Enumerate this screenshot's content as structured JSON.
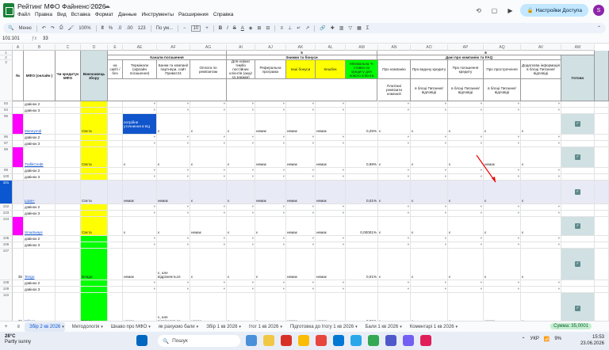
{
  "doc": {
    "title": "Рейтинг МФО Файненс 2026"
  },
  "menu": [
    "Файл",
    "Правка",
    "Вид",
    "Вставка",
    "Формат",
    "Данные",
    "Инструменты",
    "Расширения",
    "Справка"
  ],
  "share_label": "Настройки Доступа",
  "avatar_letter": "S",
  "toolbar": {
    "search": "Меню",
    "zoom": "100%",
    "currency": "₴",
    "percent": "%",
    "decimals": ".0",
    ".00": ".00",
    "format": "123",
    "font": "По ум...",
    "fontsize": "10"
  },
  "formula": {
    "cell": "101:101",
    "value": "33"
  },
  "columns": [
    "",
    "A",
    "B",
    "C",
    "D",
    "E",
    "AE",
    "AF",
    "AG",
    "AI",
    "AJ",
    "AK",
    "AL",
    "AM",
    "AN",
    "AO",
    "AP",
    "AQ",
    "AV",
    "AW"
  ],
  "head": {
    "row1_5": "5",
    "row1_6": "6",
    "channels": "Канали погашення",
    "discounts": "Знижки та бонуси",
    "faq": "Дані про компанію та FAQ",
    "no": "№",
    "mfo": "МФО (онлайн )",
    "credit": "Чи кредитує МФО",
    "executor": "Виконавець збору",
    "h_site": "на сайті / без",
    "h_terminal": "Термінали (офлайн погашення)",
    "h_bank": "Банки та компанії партнери, сайт Приват24",
    "h_req": "Оплата по реквізитам",
    "h_new": "Для нових/ тимбо постійних клієнтів (акції та знижки)",
    "h_ref": "Реферальна програма",
    "h_other": "Інші бонуси",
    "h_cash": "Кешбек",
    "h_min": "Мінімальна % ставка по кредиту для нового клієнта",
    "h_about": "Про компанію",
    "h_issue": "Про видачу кредиту",
    "h_repay": "Про погашення кредиту",
    "h_delay": "Про прострочення",
    "h_extra": "Додаткова інформація в блоці Питання/відповіді",
    "h_ready": "Готово",
    "h_pay": "Платіжні реквізити компанії",
    "h_block": "в блоці Питання/відповіді",
    "h_block2": "в блоці Питання/відповіді",
    "h_block3": "в блоці Питання/відповіді"
  },
  "rows": [
    {
      "num": "93",
      "b": "дзвінок 2"
    },
    {
      "num": "94",
      "b": "дзвінок 3"
    },
    {
      "num": "95",
      "no": "",
      "mfo": "Moneymdi",
      "exec": "Свєта",
      "ae": "потрібне уточнення в КЦ",
      "af": "є",
      "ag": "є",
      "ai": "є",
      "aj": "немає",
      "ak": "немає",
      "al": "немає",
      "am": "0,25%",
      "an": "є",
      "ao": "є",
      "ap": "є",
      "aq": "є",
      "av": "є",
      "ready": true
    },
    {
      "num": "96",
      "b": "дзвінок 2"
    },
    {
      "num": "97",
      "b": "дзвінок 3"
    },
    {
      "num": "98",
      "mfo": "TrafikCredit",
      "exec": "Свєта",
      "ae": "є",
      "af": "є",
      "ag": "є",
      "ai": "є",
      "aj": "немає",
      "ak": "немає",
      "al": "немає",
      "am": "0,99%",
      "an": "є",
      "ao": "є",
      "ap": "є",
      "aq": "немає",
      "av": "є",
      "ready": true
    },
    {
      "num": "99",
      "b": "дзвінок 2"
    },
    {
      "num": "100",
      "b": "дзвінок 3"
    },
    {
      "num": "101",
      "mfo": "Loan+",
      "exec": "Свєта",
      "ae": "немає",
      "af": "немає",
      "ag": "є",
      "ai": "є",
      "aj": "немає",
      "ak": "немає",
      "al": "немає",
      "am": "0,01%",
      "an": "є",
      "ao": "є",
      "ap": "є",
      "aq": "є",
      "av": "є",
      "ready": true
    },
    {
      "num": "102",
      "b": "дзвінок 2"
    },
    {
      "num": "103",
      "b": "дзвінок 3"
    },
    {
      "num": "104",
      "mfo": "Smartways",
      "exec": "Свєта",
      "ae": "є",
      "af": "є",
      "ag": "немає",
      "ai": "є",
      "aj": "є",
      "ak": "немає",
      "al": "немає",
      "am": "0,00001%",
      "an": "є",
      "ao": "є",
      "ap": "є",
      "aq": "є",
      "av": "є",
      "ready": true
    },
    {
      "num": "105",
      "b": "дзвінок 2"
    },
    {
      "num": "106",
      "b": "дзвінок 3"
    },
    {
      "num": "107",
      "no": "35",
      "mfo": "Tengo",
      "exec": "Влада",
      "ae": "немає",
      "af": "є, але відрізняється",
      "ag": "є",
      "ai": "є",
      "aj": "є",
      "ak": "немає",
      "al": "немає",
      "am": "0,01%",
      "an": "є",
      "ao": "є",
      "ap": "є",
      "aq": "є",
      "av": "є",
      "ready": true
    },
    {
      "num": "108",
      "b": "дзвінок 2"
    },
    {
      "num": "109",
      "b": "дзвінок 3"
    },
    {
      "num": "110",
      "no": "36",
      "mfo": "Miloan",
      "exec": "Влада",
      "ae": "немає",
      "af": "є, але відрізняється",
      "ag": "немає",
      "ai": "є",
      "aj": "є",
      "ak": "немає",
      "al": "немає",
      "am": "0,01%",
      "an": "є",
      "ao": "є",
      "ap": "є",
      "aq": "немає",
      "av": "є",
      "ready": true
    }
  ],
  "sheets": [
    "Збір 2 кв 2026",
    "Методологія",
    "Шкаво про МФО",
    "як рахуємо бали",
    "Збір 1 кв 2026",
    "Ітог 1 кв 2026",
    "Підготовка до Ітогу 1 кв 2026",
    "Бали 1 кв 2026",
    "Коментарі 1 кв 2026"
  ],
  "sum": "Сумма: 35,0001",
  "taskbar": {
    "temp": "28°C",
    "weather": "Partly sunny",
    "search": "Пошук",
    "lang": "УКР",
    "time": "15:53",
    "date": "23.06.2026",
    "battery": "9%"
  }
}
